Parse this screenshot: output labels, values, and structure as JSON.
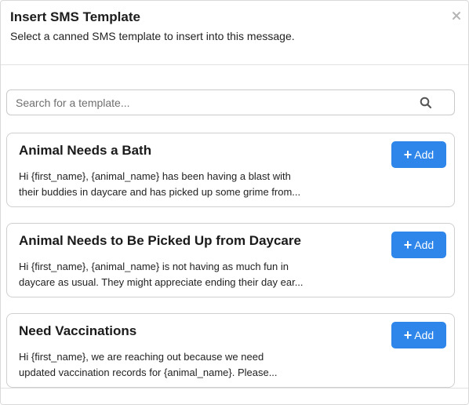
{
  "modal": {
    "title": "Insert SMS Template",
    "subtitle": "Select a canned SMS template to insert into this message.",
    "close_symbol": "×"
  },
  "search": {
    "placeholder": "Search for a template...",
    "value": "",
    "icon": "search-icon"
  },
  "templates": [
    {
      "title": "Animal Needs a Bath",
      "preview_line1": "Hi {first_name}, {animal_name} has been having a blast with",
      "preview_line2": "their buddies in daycare and has picked up some grime from...",
      "add_label": "Add",
      "add_icon": "+"
    },
    {
      "title": "Animal Needs to Be Picked Up from Daycare",
      "preview_line1": "Hi {first_name}, {animal_name} is not having as much fun in",
      "preview_line2": "daycare as usual. They might appreciate ending their day ear...",
      "add_label": "Add",
      "add_icon": "+"
    },
    {
      "title": "Need Vaccinations",
      "preview_line1": "Hi {first_name}, we are reaching out because we need",
      "preview_line2": "updated vaccination records for {animal_name}. Please...",
      "add_label": "Add",
      "add_icon": "+"
    }
  ],
  "colors": {
    "accent": "#2f86ea"
  }
}
